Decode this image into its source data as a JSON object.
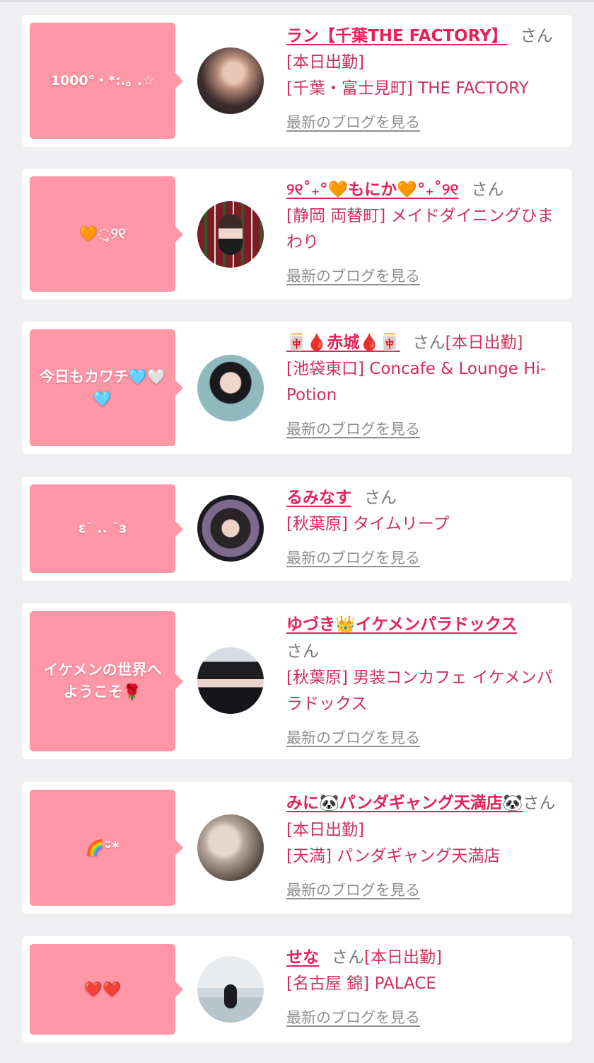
{
  "blog_link_label": "最新のブログを見る",
  "honorific": "さん",
  "cards": [
    {
      "bubble": "1000°・*:.｡ .☆",
      "name": "ラン【千葉THE FACTORY】",
      "status": "",
      "status_under": "[本日出勤]",
      "shop": "[千葉・富士見町] THE FACTORY"
    },
    {
      "bubble": "🧡◌̥୨୧",
      "name": "୨୧˚₊°🧡もにか🧡°₊˚୨୧",
      "status": "",
      "status_under": "",
      "shop": "[静岡 両替町] メイドダイニングひまわり"
    },
    {
      "bubble": "今日もカワチ🩵🤍🩵",
      "name": "🀄🩸赤城🩸🀄",
      "status": "[本日出勤]",
      "status_under": "",
      "shop": "[池袋東口] Concafe & Lounge Hi-Potion"
    },
    {
      "bubble": "ɛ˘ .. ˘з",
      "name": "るみなす",
      "status": "",
      "status_under": "",
      "shop": "[秋葉原] タイムリープ"
    },
    {
      "bubble": "イケメンの世界へようこそ🌹",
      "name": "ゆづき👑イケメンパラドックス",
      "status": "",
      "status_under": "",
      "shop": "[秋葉原] 男装コンカフェ イケメンパラドックス"
    },
    {
      "bubble": "🌈ᵕ̈*",
      "name": "みに🐼パンダギャング天満店🐼",
      "status": "",
      "status_under": "[本日出勤]",
      "shop": "[天満] パンダギャング天満店"
    },
    {
      "bubble": "❤️❤️",
      "name": "せな",
      "status": "[本日出勤]",
      "status_under": "",
      "shop": "[名古屋 錦] PALACE"
    }
  ],
  "colors": {
    "background": "#efeff1",
    "bubble": "#ff97a6",
    "name": "#e52157",
    "shop": "#cf2f5a",
    "link": "#8f8f8f"
  }
}
